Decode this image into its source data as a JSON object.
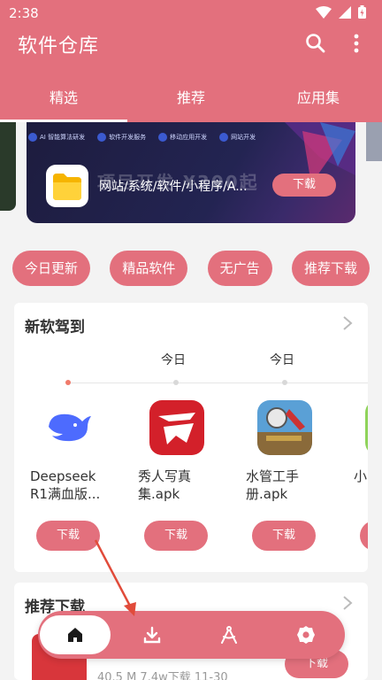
{
  "status_bar": {
    "time": "2:38"
  },
  "app_bar": {
    "title": "软件仓库"
  },
  "tabs": [
    {
      "label": "精选",
      "active": true
    },
    {
      "label": "推荐",
      "active": false
    },
    {
      "label": "应用集",
      "active": false
    }
  ],
  "banner": {
    "tags": [
      "AI 智能算法研发",
      "软件开发服务",
      "移动应用开发",
      "网站开发"
    ],
    "ghost_text": "项目开发 ¥300起",
    "text": "网站/系统/软件/小程序/A...",
    "button_label": "下载"
  },
  "chips": [
    "今日更新",
    "精品软件",
    "无广告",
    "推荐下载"
  ],
  "new_software": {
    "title": "新软驾到",
    "timeline_labels": [
      "今日",
      "今日"
    ],
    "apps": [
      {
        "name": "Deepseek R1满血版...",
        "button_label": "下载"
      },
      {
        "name": "秀人写真集.apk",
        "button_label": "下载"
      },
      {
        "name": "水管工手册.apk",
        "button_label": "下载"
      },
      {
        "name": "小限",
        "button_label": ""
      }
    ]
  },
  "recommended": {
    "title": "推荐下载",
    "meta": "40.5 M  7.4w下载  11-30",
    "button_label": "下载"
  },
  "bottom_nav": [
    {
      "icon": "home-icon",
      "active": true
    },
    {
      "icon": "download-icon",
      "active": false
    },
    {
      "icon": "compass-icon",
      "active": false
    },
    {
      "icon": "settings-icon",
      "active": false
    }
  ],
  "colors": {
    "primary": "#e3707d",
    "background": "#f3f3f3",
    "card": "#ffffff",
    "annotation_arrow": "#e14b3a"
  }
}
